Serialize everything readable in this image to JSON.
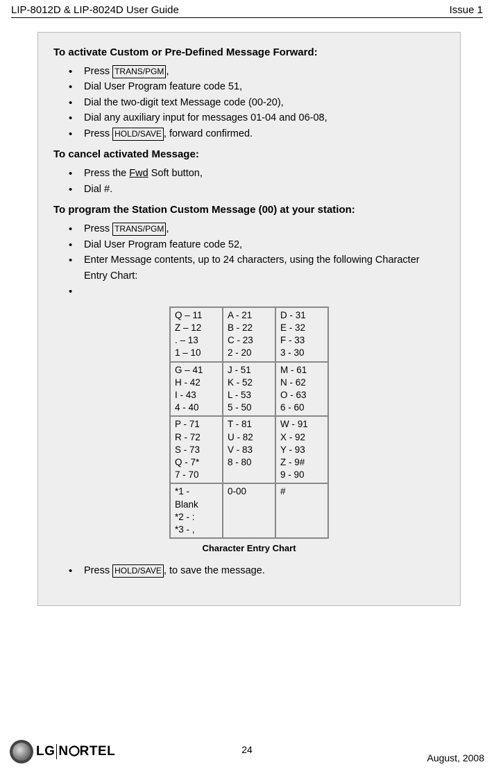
{
  "header": {
    "left": "LIP-8012D & LIP-8024D User Guide",
    "right": "Issue 1"
  },
  "section1": {
    "heading": "To activate Custom or Pre-Defined Message Forward:",
    "items": {
      "press1_a": "Press ",
      "key1": "TRANS/PGM",
      "press1_b": ",",
      "li2": "Dial User Program feature code 51,",
      "li3": "Dial the two-digit text Message code (00-20),",
      "li4": "Dial any auxiliary input for messages 01-04 and 06-08,",
      "press5_a": "Press ",
      "key5": "HOLD/SAVE",
      "press5_b": ", forward confirmed."
    }
  },
  "section2": {
    "heading": "To cancel activated Message:",
    "items": {
      "li1_a": "Press the ",
      "li1_u": "Fwd",
      "li1_b": " Soft button,",
      "li2": "Dial #."
    }
  },
  "section3": {
    "heading": "To program the Station Custom Message (00) at your station:",
    "items": {
      "press1_a": "Press ",
      "key1": "TRANS/PGM",
      "press1_b": ",",
      "li2": "Dial User Program feature code 52,",
      "li3": "Enter Message contents, up to 24 characters, using the following Character Entry Chart:"
    }
  },
  "chart_data": {
    "type": "table",
    "title": "Character Entry Chart",
    "cells": [
      [
        "Q – 11\nZ – 12\n. – 13\n1 – 10",
        "A - 21\nB - 22\nC - 23\n2 - 20",
        "D - 31\nE - 32\nF - 33\n3 - 30"
      ],
      [
        "G – 41\nH - 42\nI - 43\n4 - 40",
        "J - 51\nK - 52\nL - 53\n5 - 50",
        "M - 61\nN - 62\nO - 63\n6 - 60"
      ],
      [
        "P - 71\nR - 72\nS - 73\nQ - 7*\n7 - 70",
        "T - 81\nU - 82\nV - 83\n8 - 80",
        "W - 91\nX - 92\nY - 93\nZ - 9#\n9 - 90"
      ],
      [
        "*1 -\nBlank\n*2 - :\n*3 - ,",
        "0-00",
        "#"
      ]
    ]
  },
  "section4": {
    "press_a": "Press ",
    "key": "HOLD/SAVE",
    "press_b": ", to save the message."
  },
  "footer": {
    "logo_text_a": "LG",
    "logo_text_b": "N",
    "logo_text_c": "RTEL",
    "page_num": "24",
    "date": "August, 2008"
  }
}
